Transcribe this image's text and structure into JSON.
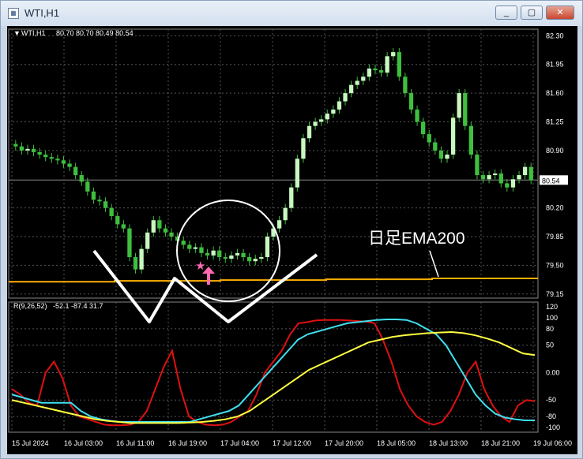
{
  "window": {
    "title": "WTI,H1"
  },
  "header": {
    "symbol": "WTI,H1",
    "ohlc": "80.70 80.70 80.49 80.54"
  },
  "price_axis": {
    "ticks": [
      "82.30",
      "81.95",
      "81.60",
      "81.25",
      "80.90",
      "80.54",
      "80.20",
      "79.85",
      "79.50",
      "79.15"
    ],
    "current_price": "80.54"
  },
  "osc_header": {
    "label": "R(9,26,52)",
    "values": "-52.1 -87.4 31.7"
  },
  "osc_axis": {
    "ticks": [
      "120",
      "100",
      "80",
      "50",
      "0.00",
      "-50",
      "-80",
      "-100"
    ]
  },
  "time_axis": {
    "ticks": [
      "15 Jul 2024",
      "16 Jul 03:00",
      "16 Jul 11:00",
      "16 Jul 19:00",
      "17 Jul 04:00",
      "17 Jul 12:00",
      "17 Jul 20:00",
      "18 Jul 05:00",
      "18 Jul 13:00",
      "18 Jul 21:00",
      "19 Jul 06:00"
    ]
  },
  "annotation": {
    "text": "日足EMA200"
  },
  "colors": {
    "bull": "#c8f7c0",
    "bear": "#3fbf3f",
    "ema": "#ffb000",
    "osc_red": "#e01010",
    "osc_cyan": "#40e0f0",
    "osc_yellow": "#ffff40",
    "annotation": "#ffffff",
    "arrow": "#ff6ab0"
  },
  "chart_data": {
    "type": "candlestick",
    "price_range": [
      79.1,
      82.38
    ],
    "ema200_level": [
      79.3,
      79.31,
      79.32,
      79.33,
      79.34
    ],
    "closes": [
      80.95,
      80.9,
      80.92,
      80.88,
      80.85,
      80.82,
      80.8,
      80.78,
      80.74,
      80.7,
      80.6,
      80.52,
      80.4,
      80.3,
      80.28,
      80.2,
      80.1,
      80.0,
      79.95,
      79.6,
      79.45,
      79.7,
      79.9,
      80.05,
      79.95,
      79.9,
      79.85,
      79.8,
      79.75,
      79.7,
      79.72,
      79.65,
      79.62,
      79.68,
      79.6,
      79.58,
      79.62,
      79.65,
      79.6,
      79.55,
      79.58,
      79.6,
      79.85,
      79.95,
      80.05,
      80.2,
      80.45,
      80.8,
      81.05,
      81.2,
      81.25,
      81.28,
      81.35,
      81.4,
      81.5,
      81.6,
      81.7,
      81.75,
      81.8,
      81.9,
      81.88,
      81.85,
      82.05,
      82.1,
      81.8,
      81.6,
      81.4,
      81.25,
      81.1,
      81.0,
      80.9,
      80.8,
      80.85,
      81.3,
      81.6,
      81.2,
      80.85,
      80.6,
      80.55,
      80.6,
      80.62,
      80.5,
      80.45,
      80.55,
      80.6,
      80.7,
      80.54
    ],
    "osc_series": [
      {
        "values": [
          -30,
          -40,
          -55,
          -60,
          0,
          20,
          -10,
          -60,
          -80,
          -85,
          -90,
          -95,
          -96,
          -96,
          -95,
          -90,
          -70,
          -30,
          10,
          40,
          -30,
          -80,
          -90,
          -95,
          -96,
          -95,
          -90,
          -80,
          -70,
          -40,
          0,
          20,
          40,
          70,
          90,
          92,
          95,
          96,
          96,
          96,
          95,
          94,
          93,
          90,
          60,
          20,
          -30,
          -60,
          -80,
          -90,
          -95,
          -90,
          -70,
          -40,
          0,
          20,
          -30,
          -60,
          -80,
          -90,
          -60,
          -50,
          -52
        ]
      },
      {
        "values": [
          -40,
          -45,
          -50,
          -55,
          -55,
          -55,
          -55,
          -70,
          -80,
          -85,
          -88,
          -90,
          -90,
          -90,
          -90,
          -90,
          -90,
          -90,
          -90,
          -85,
          -80,
          -75,
          -70,
          -60,
          -40,
          -20,
          0,
          20,
          40,
          60,
          70,
          75,
          80,
          85,
          90,
          92,
          94,
          96,
          97,
          97,
          96,
          90,
          80,
          70,
          50,
          20,
          -10,
          -40,
          -60,
          -75,
          -82,
          -85,
          -87,
          -87
        ]
      },
      {
        "values": [
          -50,
          -55,
          -60,
          -65,
          -70,
          -75,
          -80,
          -85,
          -88,
          -90,
          -92,
          -92,
          -92,
          -92,
          -92,
          -91,
          -90,
          -88,
          -85,
          -80,
          -70,
          -55,
          -40,
          -25,
          -10,
          5,
          15,
          25,
          35,
          45,
          55,
          60,
          65,
          68,
          70,
          72,
          73,
          74,
          72,
          68,
          62,
          55,
          45,
          35,
          32
        ]
      }
    ]
  }
}
